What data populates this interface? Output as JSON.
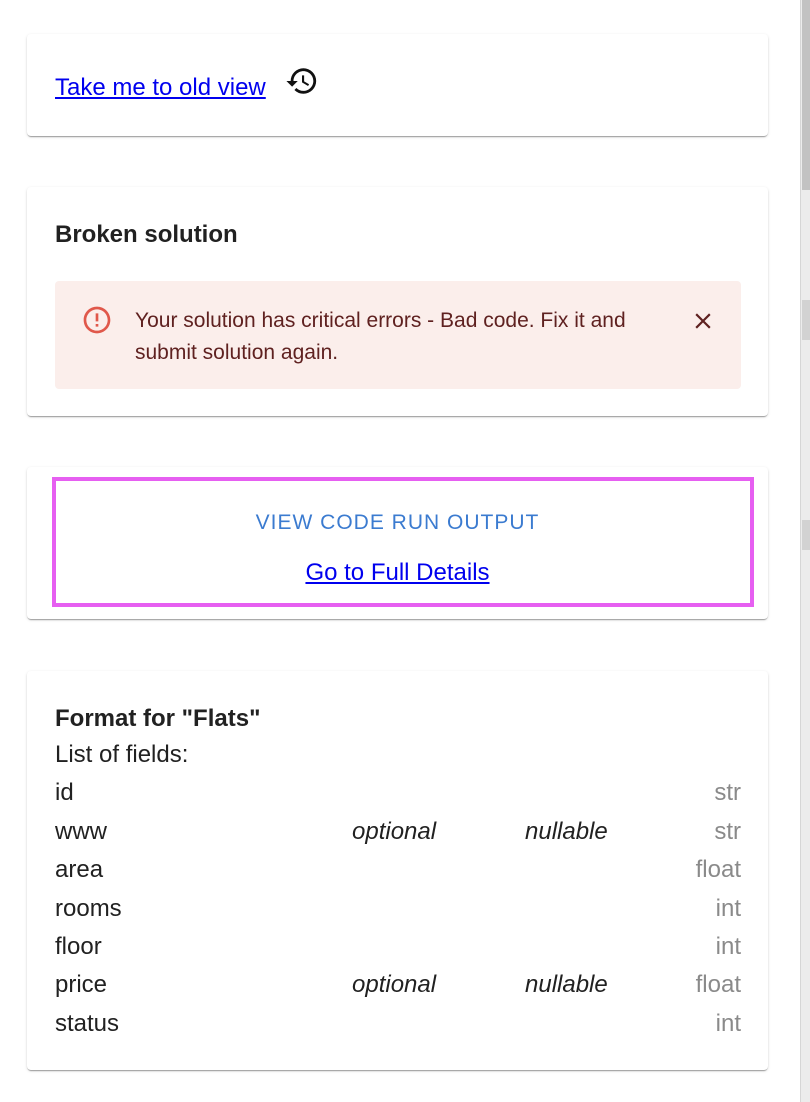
{
  "old_view": {
    "link_label": "Take me to old view",
    "icon": "history-icon"
  },
  "broken": {
    "title": "Broken solution",
    "alert": {
      "icon": "error-outline-icon",
      "message": "Your solution has critical errors - Bad code. Fix it and submit solution again.",
      "close_icon": "close-icon",
      "color_bg": "#fbeeeb",
      "color_text": "#5f2120",
      "color_icon": "#e0584b"
    }
  },
  "output": {
    "view_button_label": "VIEW CODE RUN OUTPUT",
    "details_link_label": "Go to Full Details",
    "highlight_color": "#e65ff1",
    "button_color": "#3b7bd0"
  },
  "format": {
    "title": "Format for \"Flats\"",
    "fields_heading": "List of fields:",
    "fields": [
      {
        "name": "id",
        "optional": "",
        "nullable": "",
        "type": "str"
      },
      {
        "name": "www",
        "optional": "optional",
        "nullable": "nullable",
        "type": "str"
      },
      {
        "name": "area",
        "optional": "",
        "nullable": "",
        "type": "float"
      },
      {
        "name": "rooms",
        "optional": "",
        "nullable": "",
        "type": "int"
      },
      {
        "name": "floor",
        "optional": "",
        "nullable": "",
        "type": "int"
      },
      {
        "name": "price",
        "optional": "optional",
        "nullable": "nullable",
        "type": "float"
      },
      {
        "name": "status",
        "optional": "",
        "nullable": "",
        "type": "int"
      }
    ]
  }
}
